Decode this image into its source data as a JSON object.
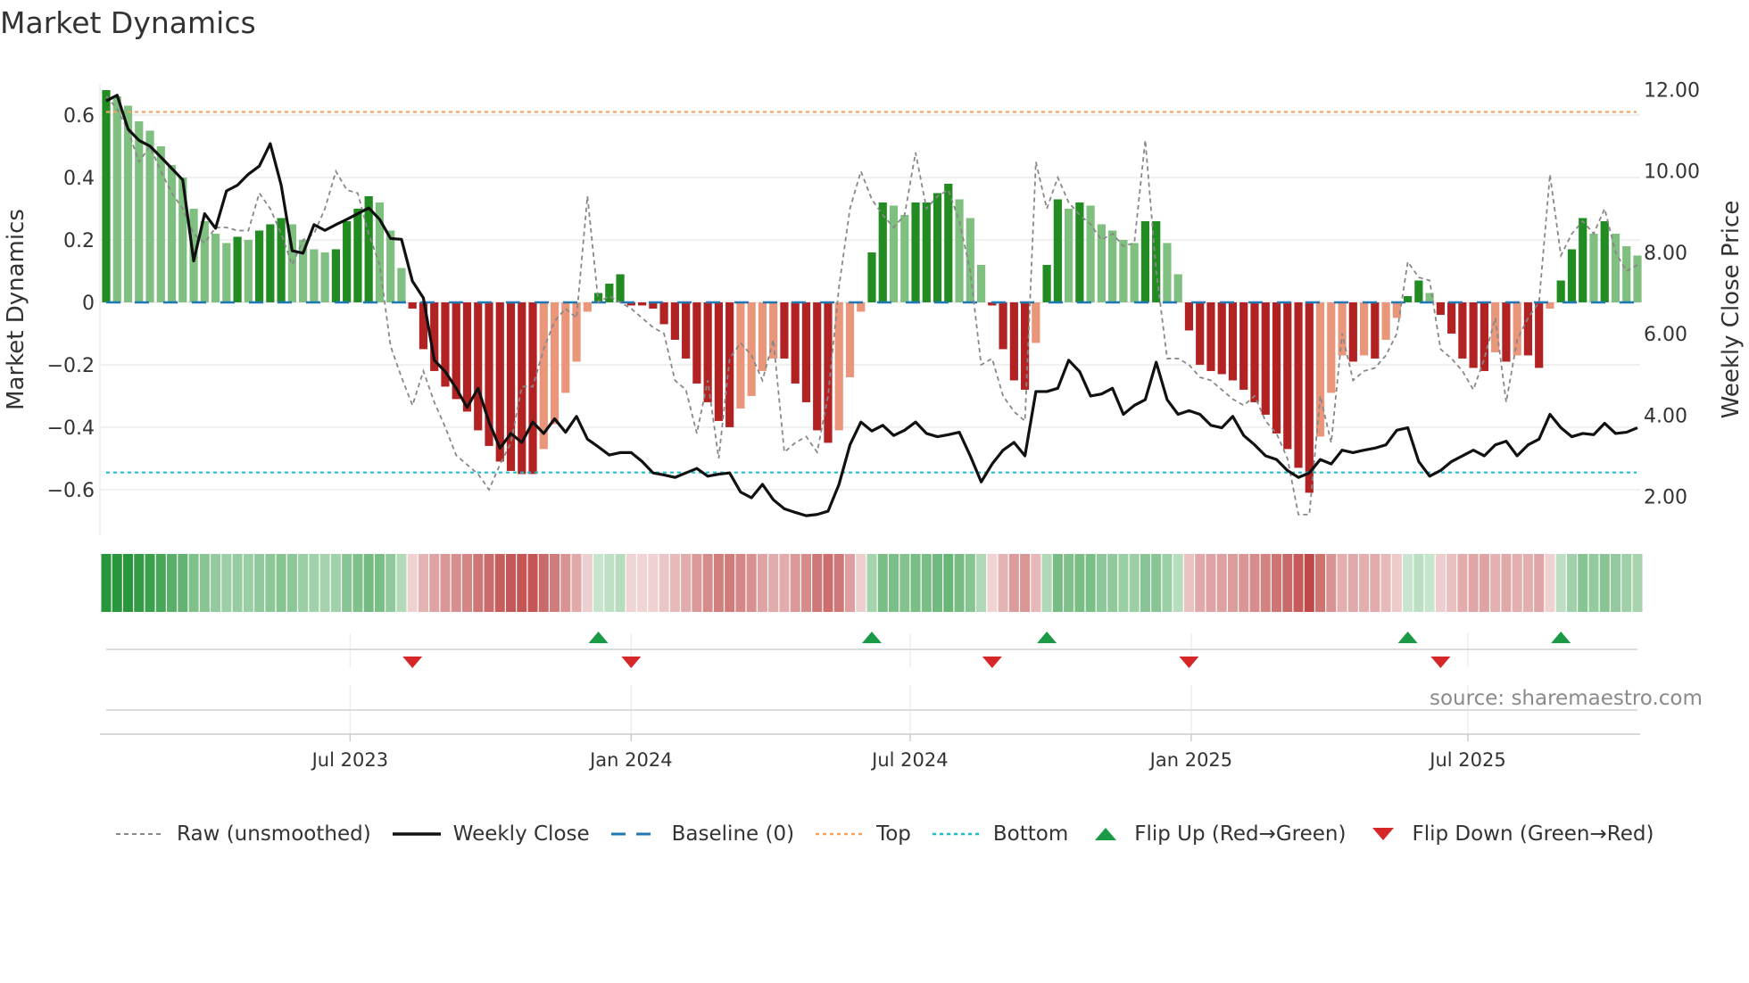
{
  "title": "Market Dynamics",
  "source": "source: sharemaestro.com",
  "colors": {
    "pos_strong": "#228b22",
    "pos_weak": "#7fbf7f",
    "neg_strong": "#b22222",
    "neg_weak": "#e9967a",
    "close": "#111111",
    "raw": "#888888",
    "baseline": "#1f77b4",
    "top": "#f4a460",
    "bottom": "#17becf",
    "flip_up": "#1a9a45",
    "flip_down": "#d62728"
  },
  "legend": [
    {
      "key": "raw",
      "label": "Raw (unsmoothed)"
    },
    {
      "key": "close",
      "label": "Weekly Close"
    },
    {
      "key": "baseline",
      "label": "Baseline (0)"
    },
    {
      "key": "top",
      "label": "Top"
    },
    {
      "key": "bottom",
      "label": "Bottom"
    },
    {
      "key": "flip_up",
      "label": "Flip Up (Red→Green)"
    },
    {
      "key": "flip_down",
      "label": "Flip Down (Green→Red)"
    }
  ],
  "chart_data": {
    "type": "bar",
    "title": "Market Dynamics",
    "ylabel": "Market Dynamics",
    "y2label": "Weekly Close Price",
    "ylim": [
      -0.746,
      0.7
    ],
    "y2lim": [
      1.05,
      12.14
    ],
    "yticks": [
      0.6,
      0.4,
      0.2,
      0,
      -0.2,
      -0.4,
      -0.6
    ],
    "ytick_labels": [
      "0.6",
      "0.4",
      "0.2",
      "0",
      "−0.2",
      "−0.4",
      "−0.6"
    ],
    "y2ticks": [
      12,
      10,
      8,
      6,
      4,
      2
    ],
    "y2tick_labels": [
      "12.00",
      "10.00",
      "8.00",
      "6.00",
      "4.00",
      "2.00"
    ],
    "xticks": [
      {
        "label": "Jul 2023",
        "week": 22.3
      },
      {
        "label": "Jan 2024",
        "week": 48.0
      },
      {
        "label": "Jul 2024",
        "week": 73.5
      },
      {
        "label": "Jan 2025",
        "week": 99.2
      },
      {
        "label": "Jul 2025",
        "week": 124.5
      }
    ],
    "top_level": 0.61,
    "bottom_level": -0.545,
    "baseline": 0,
    "grid": true,
    "legend_position": "bottom",
    "smoothed": [
      0.68,
      0.66,
      0.63,
      0.58,
      0.55,
      0.5,
      0.44,
      0.4,
      0.3,
      0.26,
      0.22,
      0.19,
      0.21,
      0.2,
      0.23,
      0.25,
      0.27,
      0.25,
      0.2,
      0.17,
      0.16,
      0.17,
      0.26,
      0.3,
      0.34,
      0.32,
      0.23,
      0.11,
      -0.02,
      -0.15,
      -0.22,
      -0.27,
      -0.31,
      -0.35,
      -0.41,
      -0.46,
      -0.51,
      -0.54,
      -0.55,
      -0.55,
      -0.47,
      -0.39,
      -0.29,
      -0.19,
      -0.03,
      0.03,
      0.06,
      0.09,
      -0.01,
      -0.01,
      -0.02,
      -0.07,
      -0.12,
      -0.18,
      -0.26,
      -0.32,
      -0.38,
      -0.4,
      -0.34,
      -0.3,
      -0.22,
      -0.18,
      -0.18,
      -0.26,
      -0.32,
      -0.41,
      -0.45,
      -0.41,
      -0.24,
      -0.03,
      0.16,
      0.32,
      0.31,
      0.28,
      0.32,
      0.32,
      0.35,
      0.38,
      0.33,
      0.27,
      0.12,
      -0.01,
      -0.15,
      -0.25,
      -0.28,
      -0.13,
      0.12,
      0.33,
      0.3,
      0.32,
      0.31,
      0.25,
      0.23,
      0.2,
      0.19,
      0.26,
      0.26,
      0.19,
      0.09,
      -0.09,
      -0.2,
      -0.22,
      -0.23,
      -0.25,
      -0.28,
      -0.32,
      -0.36,
      -0.42,
      -0.47,
      -0.53,
      -0.61,
      -0.43,
      -0.29,
      -0.17,
      -0.19,
      -0.17,
      -0.18,
      -0.12,
      -0.05,
      0.02,
      0.07,
      0.03,
      -0.04,
      -0.1,
      -0.18,
      -0.21,
      -0.22,
      -0.16,
      -0.19,
      -0.17,
      -0.17,
      -0.21,
      -0.02,
      0.07,
      0.17,
      0.27,
      0.22,
      0.26,
      0.22,
      0.18,
      0.15
    ],
    "raw": [
      0.66,
      0.62,
      0.55,
      0.45,
      0.5,
      0.42,
      0.35,
      0.3,
      0.22,
      0.19,
      0.24,
      0.24,
      0.23,
      0.23,
      0.35,
      0.3,
      0.22,
      0.12,
      0.2,
      0.22,
      0.3,
      0.42,
      0.36,
      0.35,
      0.22,
      0.12,
      -0.14,
      -0.24,
      -0.33,
      -0.22,
      -0.32,
      -0.4,
      -0.49,
      -0.52,
      -0.55,
      -0.6,
      -0.52,
      -0.45,
      -0.27,
      -0.27,
      -0.15,
      -0.06,
      -0.02,
      -0.05,
      0.34,
      0.0,
      0.02,
      0.0,
      -0.02,
      -0.05,
      -0.08,
      -0.1,
      -0.25,
      -0.28,
      -0.42,
      -0.25,
      -0.5,
      -0.18,
      -0.13,
      -0.17,
      -0.25,
      -0.12,
      -0.48,
      -0.45,
      -0.43,
      -0.48,
      -0.3,
      0.05,
      0.3,
      0.42,
      0.33,
      0.28,
      0.24,
      0.28,
      0.48,
      0.3,
      0.34,
      0.36,
      0.26,
      0.1,
      -0.2,
      -0.18,
      -0.3,
      -0.35,
      -0.38,
      0.45,
      0.3,
      0.4,
      0.32,
      0.28,
      0.25,
      0.2,
      0.22,
      0.18,
      0.19,
      0.52,
      0.1,
      -0.18,
      -0.18,
      -0.2,
      -0.24,
      -0.25,
      -0.28,
      -0.31,
      -0.33,
      -0.3,
      -0.38,
      -0.42,
      -0.5,
      -0.68,
      -0.68,
      -0.3,
      -0.45,
      -0.1,
      -0.25,
      -0.22,
      -0.21,
      -0.17,
      -0.1,
      0.13,
      0.08,
      0.07,
      -0.15,
      -0.18,
      -0.22,
      -0.28,
      -0.18,
      -0.05,
      -0.32,
      -0.12,
      -0.05,
      0.0,
      0.41,
      0.15,
      0.22,
      0.26,
      0.22,
      0.3,
      0.16,
      0.1,
      0.12
    ],
    "close": [
      11.72,
      11.86,
      11.03,
      10.75,
      10.61,
      10.34,
      10.06,
      9.78,
      7.79,
      8.95,
      8.59,
      9.51,
      9.65,
      9.92,
      10.12,
      10.67,
      9.65,
      8.04,
      7.98,
      8.68,
      8.54,
      8.68,
      8.81,
      8.95,
      9.09,
      8.81,
      8.34,
      8.32,
      7.29,
      6.88,
      5.35,
      5.07,
      4.66,
      4.19,
      4.66,
      3.83,
      3.19,
      3.55,
      3.33,
      3.83,
      3.55,
      3.91,
      3.58,
      3.97,
      3.41,
      3.22,
      3.02,
      3.08,
      3.08,
      2.86,
      2.58,
      2.53,
      2.47,
      2.58,
      2.69,
      2.5,
      2.55,
      2.58,
      2.11,
      1.97,
      2.3,
      1.92,
      1.7,
      1.61,
      1.53,
      1.56,
      1.64,
      2.3,
      3.27,
      3.83,
      3.61,
      3.75,
      3.5,
      3.63,
      3.83,
      3.55,
      3.47,
      3.52,
      3.58,
      3.0,
      2.36,
      2.8,
      3.14,
      3.33,
      3.0,
      4.58,
      4.58,
      4.66,
      5.35,
      5.07,
      4.47,
      4.52,
      4.66,
      4.02,
      4.24,
      4.38,
      5.3,
      4.38,
      4.02,
      4.11,
      4.02,
      3.75,
      3.69,
      3.97,
      3.5,
      3.27,
      3.0,
      2.91,
      2.64,
      2.47,
      2.58,
      2.91,
      2.8,
      3.14,
      3.08,
      3.14,
      3.19,
      3.27,
      3.63,
      3.69,
      2.86,
      2.5,
      2.64,
      2.86,
      3.0,
      3.14,
      3.0,
      3.27,
      3.36,
      3.0,
      3.27,
      3.41,
      4.02,
      3.69,
      3.47,
      3.55,
      3.52,
      3.8,
      3.55,
      3.58,
      3.69
    ]
  }
}
